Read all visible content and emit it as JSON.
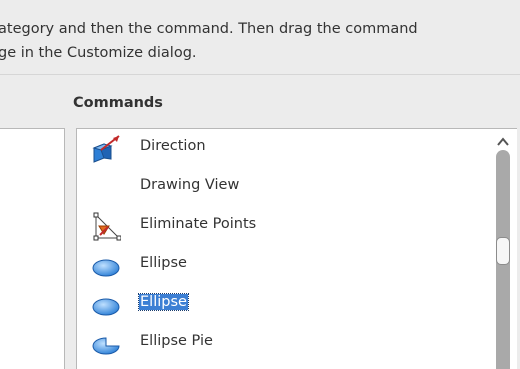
{
  "instructions": {
    "line1": "ategory and then the command. Then drag the command",
    "line2": "ge in the Customize dialog."
  },
  "commands_label": "Commands",
  "commands": [
    {
      "label": "Direction",
      "icon": "direction-icon",
      "selected": false
    },
    {
      "label": "Drawing View",
      "icon": "",
      "selected": false
    },
    {
      "label": "Eliminate Points",
      "icon": "eliminate-points-icon",
      "selected": false
    },
    {
      "label": "Ellipse",
      "icon": "ellipse-icon",
      "selected": false
    },
    {
      "label": "Ellipse",
      "icon": "ellipse-icon",
      "selected": true
    },
    {
      "label": "Ellipse Pie",
      "icon": "ellipse-pie-icon",
      "selected": false
    }
  ],
  "colors": {
    "selection": "#3c7fd4",
    "icon_blue": "#3a8ee0"
  }
}
